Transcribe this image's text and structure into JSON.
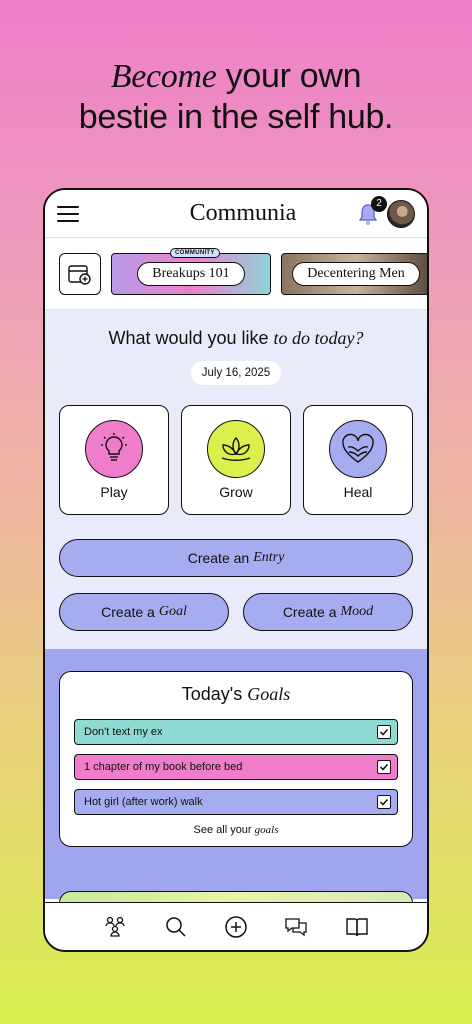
{
  "headline": {
    "italic": "Become",
    "line1_rest": " your own",
    "line2": "bestie in the self hub."
  },
  "app": {
    "logo": "Communia",
    "notifications_count": "2"
  },
  "chips": [
    {
      "tag": "COMMUNITY",
      "label": "Breakups 101"
    },
    {
      "label": "Decentering Men"
    }
  ],
  "todo": {
    "question_prefix": "What would you like ",
    "question_italic": "to do today?",
    "date": "July 16, 2025",
    "tiles": [
      {
        "label": "Play",
        "color": "#f07ccc",
        "icon": "lightbulb-icon"
      },
      {
        "label": "Grow",
        "color": "#dcef4a",
        "icon": "lotus-icon"
      },
      {
        "label": "Heal",
        "color": "#a6acf0",
        "icon": "heart-icon"
      }
    ],
    "entry": {
      "prefix": "Create an",
      "italic": "Entry"
    },
    "goal": {
      "prefix": "Create a",
      "italic": "Goal"
    },
    "mood": {
      "prefix": "Create a",
      "italic": "Mood"
    }
  },
  "goals": {
    "title_prefix": "Today's ",
    "title_italic": "Goals",
    "items": [
      {
        "text": "Don't text my ex",
        "color": "#8fd9d3",
        "checked": true
      },
      {
        "text": "1 chapter of my book before bed",
        "color": "#f07ccc",
        "checked": true
      },
      {
        "text": "Hot girl (after work) walk",
        "color": "#a6acf0",
        "checked": true
      }
    ],
    "see_all_prefix": "See all your ",
    "see_all_italic": "goals"
  },
  "nav": [
    "community-icon",
    "search-icon",
    "add-icon",
    "chat-icon",
    "journal-icon"
  ]
}
